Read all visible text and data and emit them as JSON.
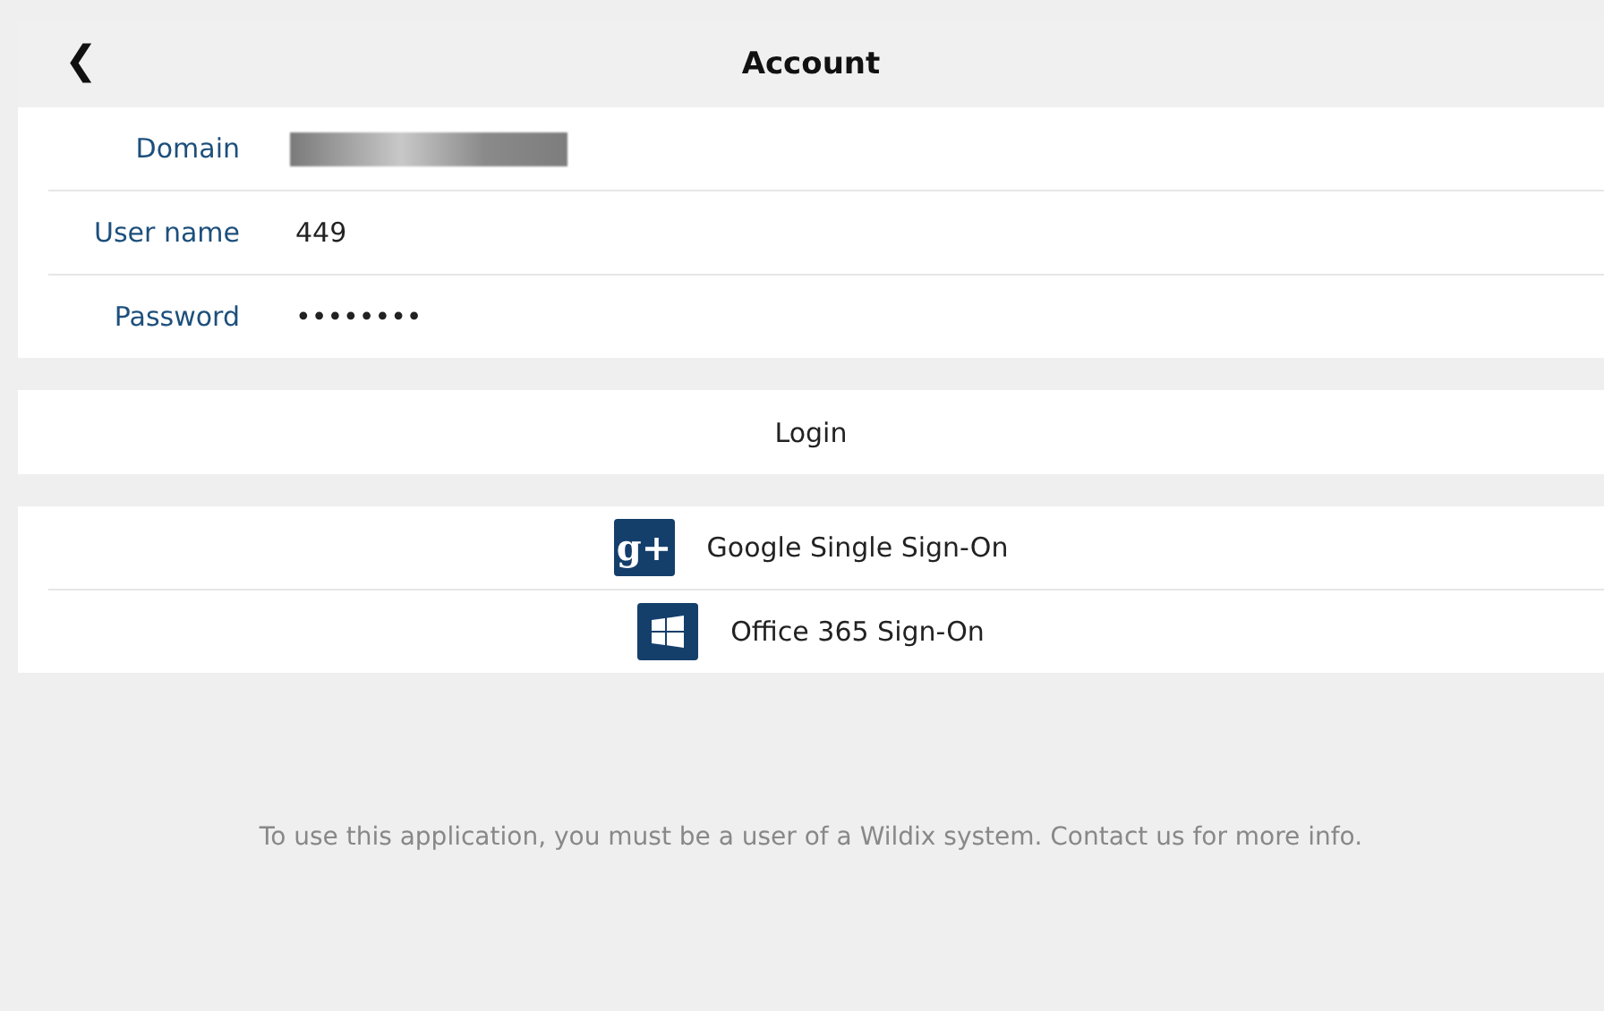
{
  "header": {
    "back_icon": "❮",
    "title": "Account"
  },
  "fields": [
    {
      "label": "Domain",
      "redacted": true
    },
    {
      "label": "User name",
      "value": "449",
      "redacted": false
    },
    {
      "label": "Password",
      "value": "••••••••",
      "redacted": false
    }
  ],
  "login_button": "Login",
  "sign_on": [
    {
      "kind": "google",
      "icon_text": "g+",
      "label": "Google Single Sign-On"
    },
    {
      "kind": "office",
      "label": "Office 365 Sign-On"
    }
  ],
  "footer_note": "To use this application, you must be a user of a Wildix system. Contact us for more info."
}
